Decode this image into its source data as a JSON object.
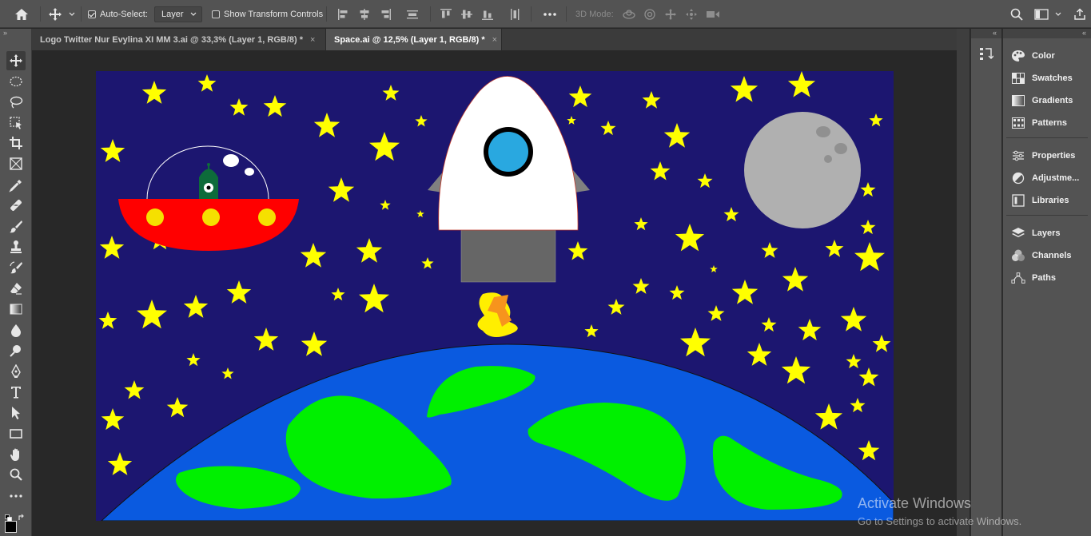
{
  "options_bar": {
    "auto_select_label": "Auto-Select:",
    "auto_select_checked": true,
    "layer_select_value": "Layer",
    "show_transform_label": "Show Transform Controls",
    "show_transform_checked": false,
    "mode_3d_label": "3D Mode:"
  },
  "tabs": [
    {
      "label": "Logo Twitter Nur Evylina XI MM 3.ai @ 33,3% (Layer 1, RGB/8) *",
      "close": "×",
      "active": false
    },
    {
      "label": "Space.ai @ 12,5% (Layer 1, RGB/8) *",
      "close": "×",
      "active": true
    }
  ],
  "panel_collapse_glyph": "»",
  "panel_expand_glyph": "«",
  "tools": [
    {
      "name": "move-tool-icon",
      "active": true
    },
    {
      "name": "elliptical-marquee-tool-icon"
    },
    {
      "name": "lasso-tool-icon"
    },
    {
      "name": "object-selection-tool-icon"
    },
    {
      "name": "crop-tool-icon"
    },
    {
      "name": "frame-tool-icon"
    },
    {
      "name": "eyedropper-tool-icon"
    },
    {
      "name": "healing-brush-tool-icon"
    },
    {
      "name": "brush-tool-icon"
    },
    {
      "name": "clone-stamp-tool-icon"
    },
    {
      "name": "history-brush-tool-icon"
    },
    {
      "name": "eraser-tool-icon"
    },
    {
      "name": "gradient-tool-icon"
    },
    {
      "name": "blur-tool-icon"
    },
    {
      "name": "dodge-tool-icon"
    },
    {
      "name": "pen-tool-icon"
    },
    {
      "name": "type-tool-icon"
    },
    {
      "name": "path-selection-tool-icon"
    },
    {
      "name": "rectangle-tool-icon"
    },
    {
      "name": "hand-tool-icon"
    },
    {
      "name": "zoom-tool-icon"
    },
    {
      "name": "more-tools-icon"
    }
  ],
  "panels": {
    "group1": [
      {
        "label": "Color",
        "icon": "color-palette-icon"
      },
      {
        "label": "Swatches",
        "icon": "swatches-grid-icon"
      },
      {
        "label": "Gradients",
        "icon": "gradients-icon"
      },
      {
        "label": "Patterns",
        "icon": "patterns-icon"
      }
    ],
    "group2": [
      {
        "label": "Properties",
        "icon": "properties-sliders-icon"
      },
      {
        "label": "Adjustme...",
        "icon": "adjustments-icon"
      },
      {
        "label": "Libraries",
        "icon": "libraries-icon"
      }
    ],
    "group3": [
      {
        "label": "Layers",
        "icon": "layers-icon"
      },
      {
        "label": "Channels",
        "icon": "channels-icon"
      },
      {
        "label": "Paths",
        "icon": "paths-icon"
      }
    ]
  },
  "watermark": {
    "line1": "Activate Windows",
    "line2": "Go to Settings to activate Windows."
  },
  "colors": {
    "sky": "#1c1670",
    "star": "#ffff00",
    "earth": "#0a5ae0",
    "land": "#00f000",
    "saucer": "#ff0000",
    "moon": "#b0b0b0",
    "rocket_window": "#29a8e0"
  }
}
